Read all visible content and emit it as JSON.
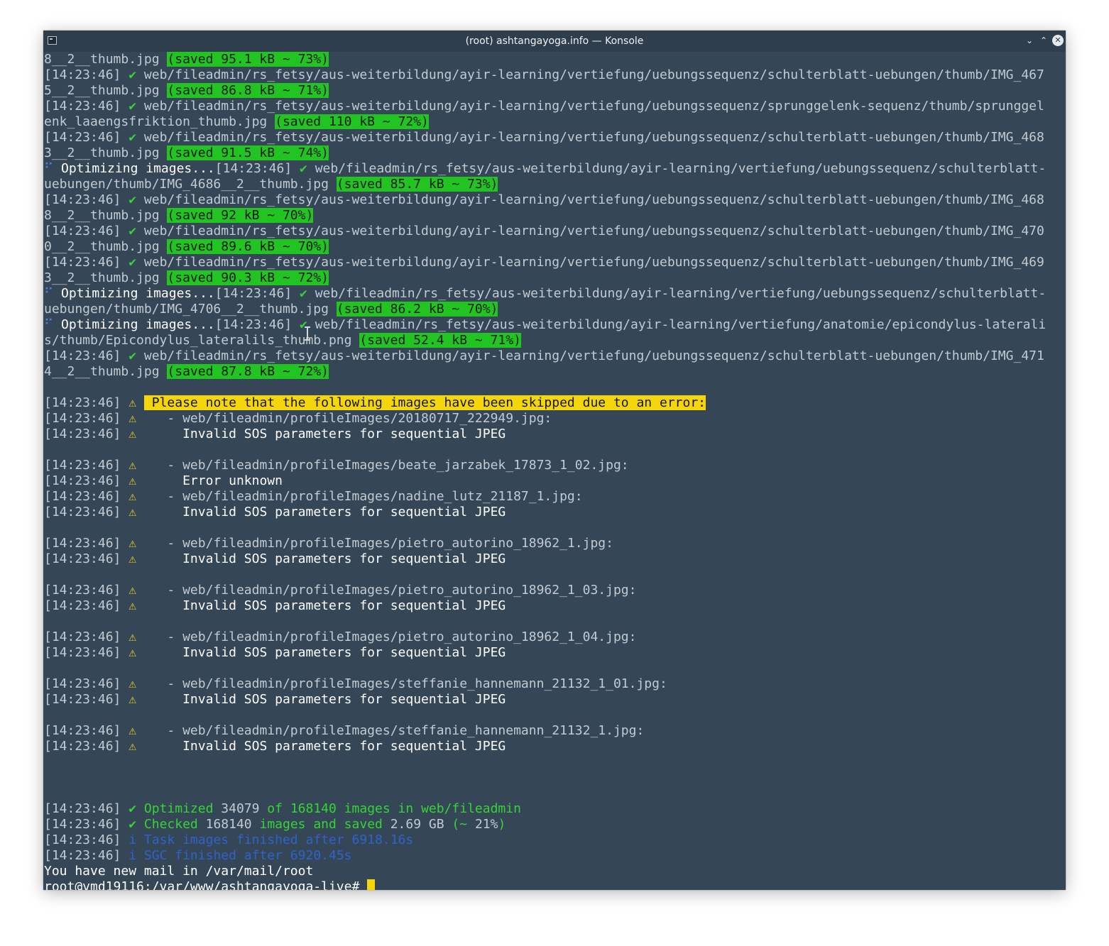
{
  "window": {
    "title": "(root) ashtangayoga.info — Konsole",
    "minimize_glyph": "⌄",
    "maximize_glyph": "⌃",
    "close_glyph": "✕"
  },
  "glyphs": {
    "check": "✔",
    "warn": "⚠",
    "info": "i",
    "spinner": "⠋"
  },
  "timestamp": "[14:23:46]",
  "prompt": {
    "mail": "You have new mail in /var/mail/root",
    "line": "root@vmd19116:/var/www/ashtangayoga-live# "
  },
  "lines": [
    {
      "type": "cont",
      "text": "8__2__thumb.jpg ",
      "saved": "(saved 95.1 kB ~ 73%)"
    },
    {
      "type": "ok",
      "text": "web/fileadmin/rs_fetsy/aus-weiterbildung/ayir-learning/vertiefung/uebungssequenz/schulterblatt-uebungen/thumb/IMG_467"
    },
    {
      "type": "cont",
      "text": "5__2__thumb.jpg ",
      "saved": "(saved 86.8 kB ~ 71%)"
    },
    {
      "type": "ok",
      "text": "web/fileadmin/rs_fetsy/aus-weiterbildung/ayir-learning/vertiefung/uebungssequenz/sprunggelenk-sequenz/thumb/sprunggel"
    },
    {
      "type": "cont",
      "text": "enk_laaengsfriktion_thumb.jpg ",
      "saved": "(saved 110 kB ~ 72%)"
    },
    {
      "type": "ok",
      "text": "web/fileadmin/rs_fetsy/aus-weiterbildung/ayir-learning/vertiefung/uebungssequenz/schulterblatt-uebungen/thumb/IMG_468"
    },
    {
      "type": "cont",
      "text": "3__2__thumb.jpg ",
      "saved": "(saved 91.5 kB ~ 74%)"
    },
    {
      "type": "spin",
      "label": "Optimizing images...",
      "text": "web/fileadmin/rs_fetsy/aus-weiterbildung/ayir-learning/vertiefung/uebungssequenz/schulterblatt-"
    },
    {
      "type": "cont",
      "text": "uebungen/thumb/IMG_4686__2__thumb.jpg ",
      "saved": "(saved 85.7 kB ~ 73%)"
    },
    {
      "type": "ok",
      "text": "web/fileadmin/rs_fetsy/aus-weiterbildung/ayir-learning/vertiefung/uebungssequenz/schulterblatt-uebungen/thumb/IMG_468"
    },
    {
      "type": "cont",
      "text": "8__2__thumb.jpg ",
      "saved": "(saved 92 kB ~ 70%)"
    },
    {
      "type": "ok",
      "text": "web/fileadmin/rs_fetsy/aus-weiterbildung/ayir-learning/vertiefung/uebungssequenz/schulterblatt-uebungen/thumb/IMG_470"
    },
    {
      "type": "cont",
      "text": "0__2__thumb.jpg ",
      "saved": "(saved 89.6 kB ~ 70%)"
    },
    {
      "type": "ok",
      "text": "web/fileadmin/rs_fetsy/aus-weiterbildung/ayir-learning/vertiefung/uebungssequenz/schulterblatt-uebungen/thumb/IMG_469"
    },
    {
      "type": "cont",
      "text": "3__2__thumb.jpg ",
      "saved": "(saved 90.3 kB ~ 72%)"
    },
    {
      "type": "spin",
      "label": "Optimizing images...",
      "text": "web/fileadmin/rs_fetsy/aus-weiterbildung/ayir-learning/vertiefung/uebungssequenz/schulterblatt-"
    },
    {
      "type": "cont",
      "text": "uebungen/thumb/IMG_4706__2__thumb.jpg ",
      "saved": "(saved 86.2 kB ~ 70%)"
    },
    {
      "type": "spin",
      "label": "Optimizing images...",
      "text": "web/fileadmin/rs_fetsy/aus-weiterbildung/ayir-learning/vertiefung/anatomie/epicondylus-laterali"
    },
    {
      "type": "cont",
      "text": "s/thumb/Epicondylus_lateralils_thumb.png ",
      "saved": "(saved 52.4 kB ~ 71%)"
    },
    {
      "type": "ok",
      "text": "web/fileadmin/rs_fetsy/aus-weiterbildung/ayir-learning/vertiefung/uebungssequenz/schulterblatt-uebungen/thumb/IMG_471"
    },
    {
      "type": "cont",
      "text": "4__2__thumb.jpg ",
      "saved": "(saved 87.8 kB ~ 72%)"
    },
    {
      "type": "blank"
    },
    {
      "type": "note",
      "text": " Please note that the following images have been skipped due to an error:"
    },
    {
      "type": "wpath",
      "text": "   - web/fileadmin/profileImages/20180717_222949.jpg:"
    },
    {
      "type": "wmsg",
      "text": "     Invalid SOS parameters for sequential JPEG"
    },
    {
      "type": "blank"
    },
    {
      "type": "wpath",
      "text": "   - web/fileadmin/profileImages/beate_jarzabek_17873_1_02.jpg:"
    },
    {
      "type": "wmsg",
      "text": "     Error unknown"
    },
    {
      "type": "wpath",
      "text": "   - web/fileadmin/profileImages/nadine_lutz_21187_1.jpg:"
    },
    {
      "type": "wmsg",
      "text": "     Invalid SOS parameters for sequential JPEG"
    },
    {
      "type": "blank"
    },
    {
      "type": "wpath",
      "text": "   - web/fileadmin/profileImages/pietro_autorino_18962_1.jpg:"
    },
    {
      "type": "wmsg",
      "text": "     Invalid SOS parameters for sequential JPEG"
    },
    {
      "type": "blank"
    },
    {
      "type": "wpath",
      "text": "   - web/fileadmin/profileImages/pietro_autorino_18962_1_03.jpg:"
    },
    {
      "type": "wmsg",
      "text": "     Invalid SOS parameters for sequential JPEG"
    },
    {
      "type": "blank"
    },
    {
      "type": "wpath",
      "text": "   - web/fileadmin/profileImages/pietro_autorino_18962_1_04.jpg:"
    },
    {
      "type": "wmsg",
      "text": "     Invalid SOS parameters for sequential JPEG"
    },
    {
      "type": "blank"
    },
    {
      "type": "wpath",
      "text": "   - web/fileadmin/profileImages/steffanie_hannemann_21132_1_01.jpg:"
    },
    {
      "type": "wmsg",
      "text": "     Invalid SOS parameters for sequential JPEG"
    },
    {
      "type": "blank"
    },
    {
      "type": "wpath",
      "text": "   - web/fileadmin/profileImages/steffanie_hannemann_21132_1.jpg:"
    },
    {
      "type": "wmsg",
      "text": "     Invalid SOS parameters for sequential JPEG"
    },
    {
      "type": "blank"
    },
    {
      "type": "blank"
    },
    {
      "type": "blank"
    },
    {
      "type": "summary",
      "parts": [
        {
          "style": "gr",
          "text": "Optimized "
        },
        {
          "style": "ts",
          "text": "34079"
        },
        {
          "style": "gr",
          "text": " of "
        },
        {
          "style": "gr",
          "text": "168140"
        },
        {
          "style": "gr",
          "text": " images in web/fileadmin"
        }
      ]
    },
    {
      "type": "summary",
      "parts": [
        {
          "style": "gr",
          "text": "Checked "
        },
        {
          "style": "ts",
          "text": "168140"
        },
        {
          "style": "gr",
          "text": " images and saved "
        },
        {
          "style": "ts",
          "text": "2.69 GB"
        },
        {
          "style": "gr",
          "text": " (~ "
        },
        {
          "style": "ts",
          "text": "21%"
        },
        {
          "style": "gr",
          "text": ")"
        }
      ]
    },
    {
      "type": "info",
      "text": "Task images finished after 6918.16s"
    },
    {
      "type": "info",
      "text": "SGC finished after 6920.45s"
    }
  ]
}
